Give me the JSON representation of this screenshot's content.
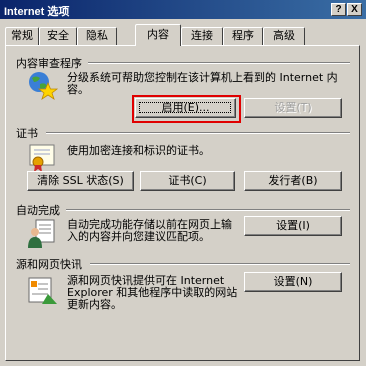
{
  "window": {
    "title": "Internet 选项",
    "help_btn": "?",
    "close_btn": "X"
  },
  "tabs": [
    {
      "label": "常规",
      "active": false
    },
    {
      "label": "安全",
      "active": false
    },
    {
      "label": "隐私",
      "active": false
    },
    {
      "label": "内容",
      "active": true
    },
    {
      "label": "连接",
      "active": false
    },
    {
      "label": "程序",
      "active": false
    },
    {
      "label": "高级",
      "active": false
    }
  ],
  "content_advisor": {
    "title": "内容审查程序",
    "desc_line1": "分级系统可帮助您控制在该计算机上看到的 Internet 内",
    "desc_line2": "容。",
    "enable_btn": "启用(E)...",
    "settings_btn": "设置(T)",
    "icon": "globe-star-icon"
  },
  "certificates": {
    "title": "证书",
    "desc": "使用加密连接和标识的证书。",
    "clear_ssl_btn": "清除 SSL 状态(S)",
    "certs_btn": "证书(C)",
    "publishers_btn": "发行者(B)",
    "icon": "certificate-icon"
  },
  "autocomplete": {
    "title": "自动完成",
    "desc_line1": "自动完成功能存储以前在网页上输",
    "desc_line2": "入的内容并向您建议匹配项。",
    "settings_btn": "设置(I)",
    "icon": "autocomplete-icon"
  },
  "feeds": {
    "title": "源和网页快讯",
    "desc_line1": "源和网页快讯提供可在 Internet",
    "desc_line2": "Explorer 和其他程序中读取的网站",
    "desc_line3": "更新内容。",
    "settings_btn": "设置(N)",
    "icon": "feeds-icon"
  },
  "colors": {
    "highlight": "#e00000",
    "titlebar": "#0a246a"
  }
}
